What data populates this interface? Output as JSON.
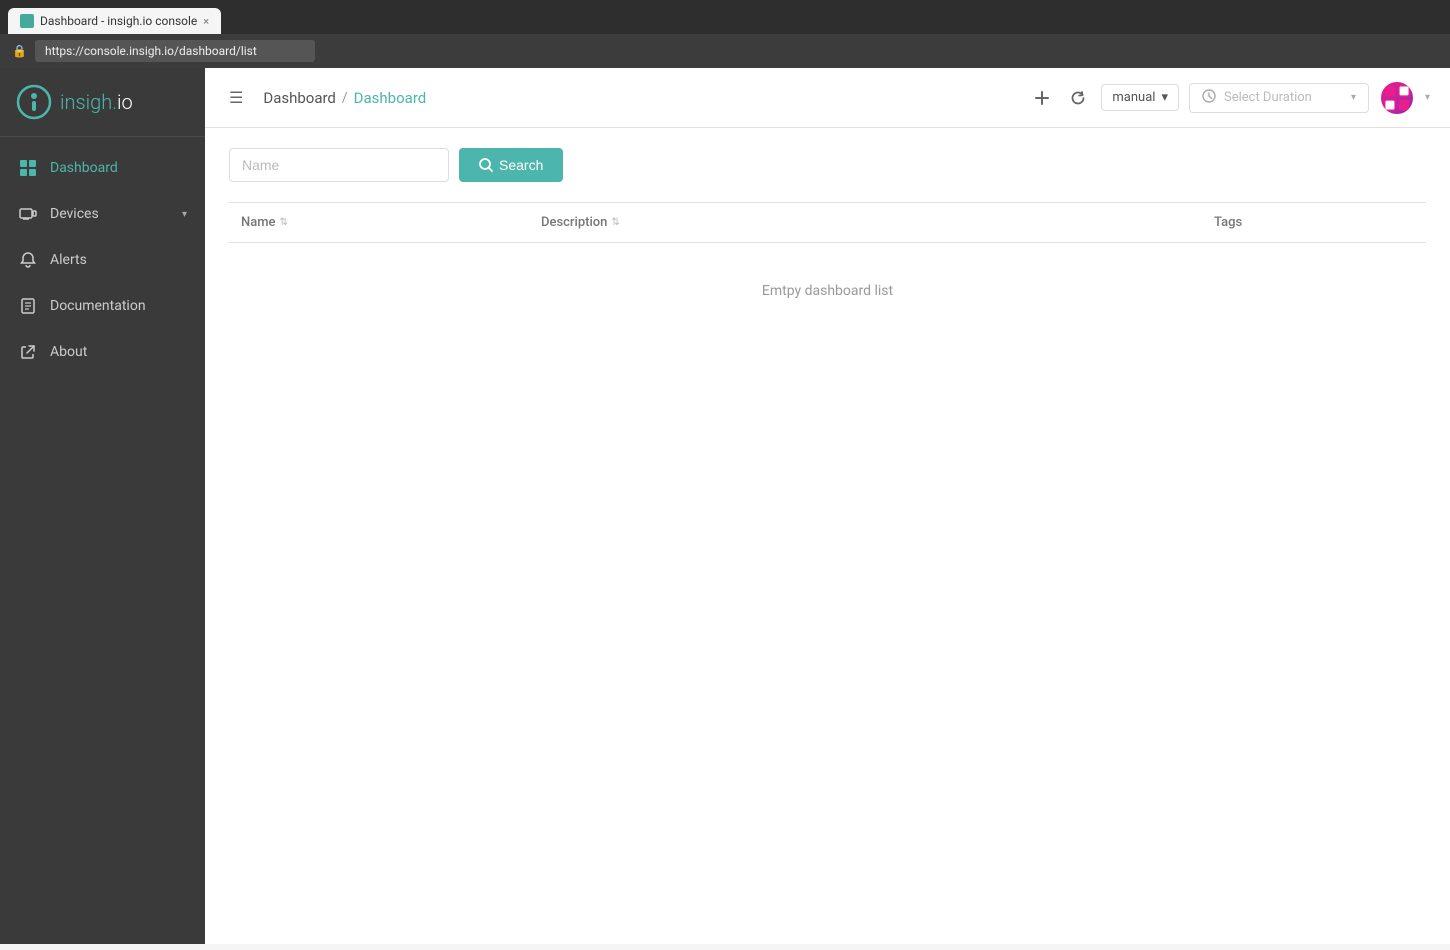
{
  "browser": {
    "tab_favicon": "🔒",
    "tab_title": "Dashboard - insigh.io console",
    "tab_close": "×",
    "address_url": "https://console.insigh.io/dashboard/list"
  },
  "sidebar": {
    "logo_text_start": "insigh",
    "logo_text_dot": ".",
    "logo_text_end": "io",
    "nav_items": [
      {
        "id": "dashboard",
        "label": "Dashboard",
        "icon": "grid",
        "active": true,
        "has_chevron": false
      },
      {
        "id": "devices",
        "label": "Devices",
        "icon": "devices",
        "active": false,
        "has_chevron": true
      },
      {
        "id": "alerts",
        "label": "Alerts",
        "icon": "bell",
        "active": false,
        "has_chevron": false
      },
      {
        "id": "documentation",
        "label": "Documentation",
        "icon": "doc",
        "active": false,
        "has_chevron": false
      },
      {
        "id": "about",
        "label": "About",
        "icon": "external",
        "active": false,
        "has_chevron": false
      }
    ]
  },
  "header": {
    "breadcrumb_root": "Dashboard",
    "breadcrumb_separator": "/",
    "breadcrumb_current": "Dashboard",
    "manual_label": "manual",
    "manual_chevron": "▾",
    "duration_placeholder": "Select Duration",
    "duration_chevron": "▾"
  },
  "content": {
    "search_placeholder": "Name",
    "search_button_label": "Search",
    "table": {
      "columns": [
        {
          "label": "Name",
          "sortable": true
        },
        {
          "label": "Description",
          "sortable": true
        },
        {
          "label": "Tags",
          "sortable": false
        }
      ],
      "empty_message": "Emtpy dashboard list"
    }
  }
}
